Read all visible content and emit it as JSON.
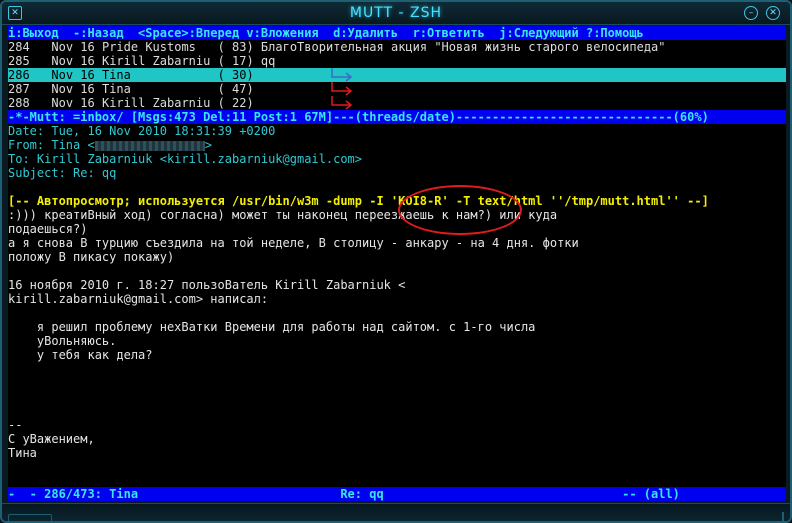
{
  "window": {
    "title": "MUTT - ZSH"
  },
  "help_bar": "i:Выход  -:Назад  <Space>:Вперед v:Вложения  d:Удалить  r:Ответить  j:Следующий ?:Помощь",
  "index_rows": [
    {
      "num": "284",
      "date": "Nov 16",
      "from": "Pride Kustoms   ",
      "size": "( 83)",
      "subject": "БлагоТворительная акция \"Новая жизнь старого велосипеда\""
    },
    {
      "num": "285",
      "date": "Nov 16",
      "from": "Kirill Zabarniu ",
      "size": "( 17)",
      "subject": "qq"
    },
    {
      "num": "286",
      "date": "Nov 16",
      "from": "Tina            ",
      "size": "( 30)",
      "subject": ""
    },
    {
      "num": "287",
      "date": "Nov 16",
      "from": "Tina            ",
      "size": "( 47)",
      "subject": ""
    },
    {
      "num": "288",
      "date": "Nov 16",
      "from": "Kirill Zabarniu ",
      "size": "( 22)",
      "subject": ""
    }
  ],
  "status_bar": "-*-Mutt: =inbox/ [Msgs:473 Del:11 Post:1 67M]---(threads/date)------------------------------(60%)",
  "headers": {
    "date": "Date: Tue, 16 Nov 2010 18:31:39 +0200",
    "from_label": "From: Tina <",
    "from_suffix": ">",
    "to": "To: Kirill Zabarniuk <kirill.zabarniuk@gmail.com>",
    "subject": "Subject: Re: qq"
  },
  "autoview": "[-- Автопросмотр; используется /usr/bin/w3m -dump -I 'KOI8-R' -T text/html ''/tmp/mutt.html'' --]",
  "body_lines": [
    ":))) креатиВный ход) согласна) может ты наконец переезжаешь к нам?) или куда",
    "подаешься?)",
    "а я снова В турцию съездила на той неделе, В столицу - анкару - на 4 дня. фотки",
    "положу В пикасу покажу)",
    "",
    "16 ноября 2010 г. 18:27 пользоВатель Kirill Zabarniuk <",
    "kirill.zabarniuk@gmail.com> написал:",
    "",
    "    я решил проблему нехВатки Времени для работы над сайтом. с 1-го числа",
    "    уВольняюсь.",
    "    у тебя как дела?",
    "",
    "",
    "",
    "",
    "--",
    "С уВажением,",
    "Тина"
  ],
  "pager_status": "-  - 286/473: Tina                            Re: qq                                 -- (all)",
  "colors": {
    "bar_bg": "#0000f0",
    "bar_fg": "#39e6f0",
    "selected_bg": "#20c6c6",
    "header_fg": "#32c8d2",
    "autoview_fg": "#f4f000",
    "thread_arrow": "#e01b1b",
    "annotation_circle": "#e01b1b"
  }
}
